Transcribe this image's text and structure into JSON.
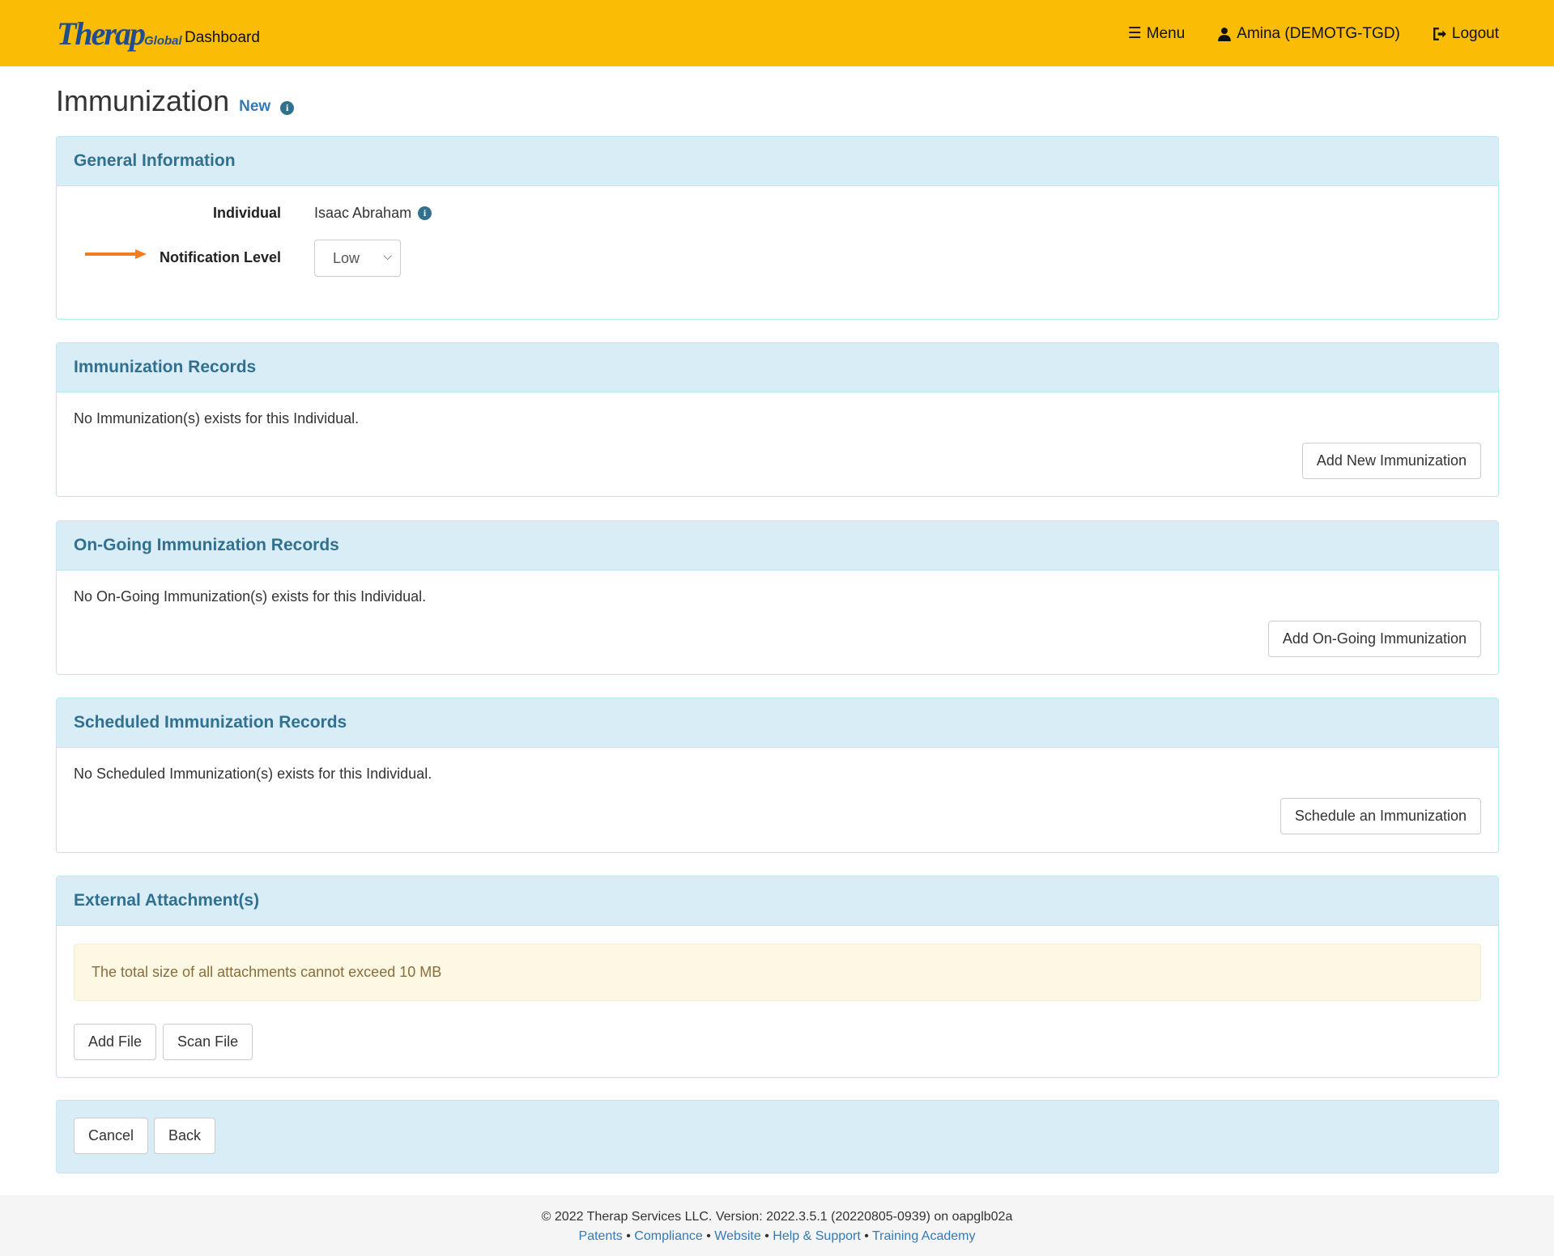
{
  "header": {
    "logo_text": "Therap",
    "logo_sub": "Global",
    "dashboard": "Dashboard",
    "menu": "Menu",
    "user": "Amina (DEMOTG-TGD)",
    "logout": "Logout"
  },
  "page": {
    "title": "Immunization",
    "status": "New"
  },
  "general": {
    "heading": "General Information",
    "individual_label": "Individual",
    "individual_value": "Isaac Abraham",
    "notification_label": "Notification Level",
    "notification_value": "Low",
    "accent": "#f47c20"
  },
  "records": {
    "heading": "Immunization Records",
    "empty": "No Immunization(s) exists for this Individual.",
    "button": "Add New Immunization"
  },
  "ongoing": {
    "heading": "On-Going Immunization Records",
    "empty": "No On-Going Immunization(s) exists for this Individual.",
    "button": "Add On-Going Immunization"
  },
  "scheduled": {
    "heading": "Scheduled Immunization Records",
    "empty": "No Scheduled Immunization(s) exists for this Individual.",
    "button": "Schedule an Immunization"
  },
  "attachments": {
    "heading": "External Attachment(s)",
    "warning": "The total size of all attachments cannot exceed 10 MB",
    "add": "Add File",
    "scan": "Scan File"
  },
  "actions": {
    "cancel": "Cancel",
    "back": "Back"
  },
  "footer": {
    "copyright": "© 2022 Therap Services LLC. Version: 2022.3.5.1 (20220805-0939) on oapglb02a",
    "links": [
      "Patents",
      "Compliance",
      "Website",
      "Help & Support",
      "Training Academy"
    ]
  }
}
